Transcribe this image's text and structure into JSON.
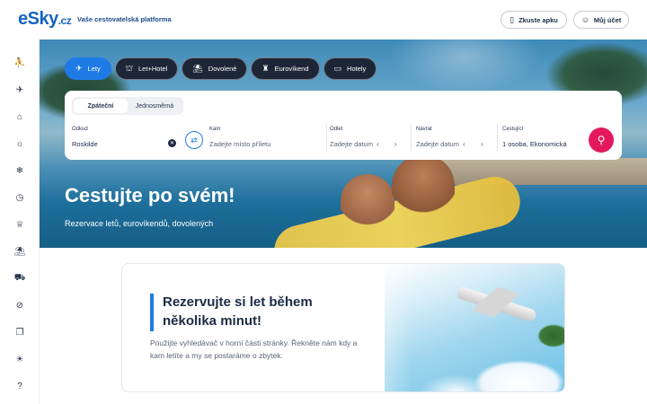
{
  "header": {
    "logo_main": "eSky",
    "logo_tld": ".cz",
    "tagline": "Vaše cestovatelská platforma",
    "app_button": "Zkuste apku",
    "account_button": "Můj účet"
  },
  "sidebar": {
    "icons": [
      "traveler-icon",
      "plane-icon",
      "hotel-icon",
      "sun-icon",
      "snowflake-icon",
      "clock-icon",
      "crown-icon",
      "beach-icon",
      "car-icon",
      "no-icon",
      "copy-icon",
      "bulb-icon",
      "help-icon"
    ]
  },
  "tabs": [
    {
      "label": "Lety",
      "icon": "plane-icon"
    },
    {
      "label": "Let+Hotel",
      "icon": "plane-hotel-icon"
    },
    {
      "label": "Dovolené",
      "icon": "beach-icon"
    },
    {
      "label": "Eurovíkend",
      "icon": "city-icon"
    },
    {
      "label": "Hotely",
      "icon": "bed-icon"
    }
  ],
  "search": {
    "trip_types": [
      "Zpáteční",
      "Jednosměrná"
    ],
    "from_label": "Odkud",
    "from_value": "Roskilde",
    "to_label": "Kam",
    "to_placeholder": "Zadejte místo příletu",
    "depart_label": "Odlet",
    "depart_placeholder": "Zadejte datum",
    "return_label": "Návrat",
    "return_placeholder": "Zadejte datum",
    "passengers_label": "Cestující",
    "passengers_value": "1 osoba, Ekonomická"
  },
  "hero": {
    "title": "Cestujte po svém!",
    "subtitle": "Rezervace letů, eurovíkendů, dovolených"
  },
  "card": {
    "title": "Rezervujte si let během několika minut!",
    "text": "Použijte vyhledávač v horní části stránky. Řekněte nám kdy a kam letíte a my se postaráme o zbytek."
  },
  "colors": {
    "accent": "#1e7be6",
    "search_button": "#e3185d",
    "dark_tab": "#1d2636"
  }
}
